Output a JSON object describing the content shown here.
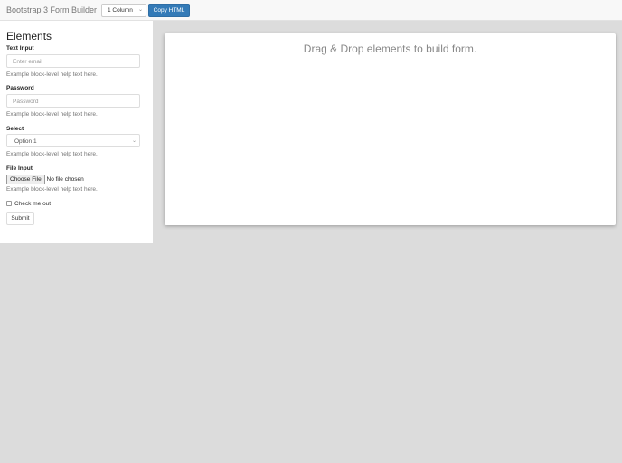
{
  "navbar": {
    "brand": "Bootstrap 3 Form Builder",
    "columns_select": "1 Column",
    "copy_button": "Copy HTML"
  },
  "sidebar": {
    "title": "Elements",
    "text_input": {
      "label": "Text Input",
      "placeholder": "Enter email",
      "help": "Example block-level help text here."
    },
    "password": {
      "label": "Password",
      "placeholder": "Password",
      "help": "Example block-level help text here."
    },
    "select": {
      "label": "Select",
      "value": "Option 1",
      "help": "Example block-level help text here."
    },
    "file_input": {
      "label": "File Input",
      "button": "Choose File",
      "status": "No file chosen",
      "help": "Example block-level help text here."
    },
    "checkbox": {
      "label": "Check me out"
    },
    "submit": "Submit"
  },
  "canvas": {
    "message": "Drag & Drop elements to build form."
  }
}
